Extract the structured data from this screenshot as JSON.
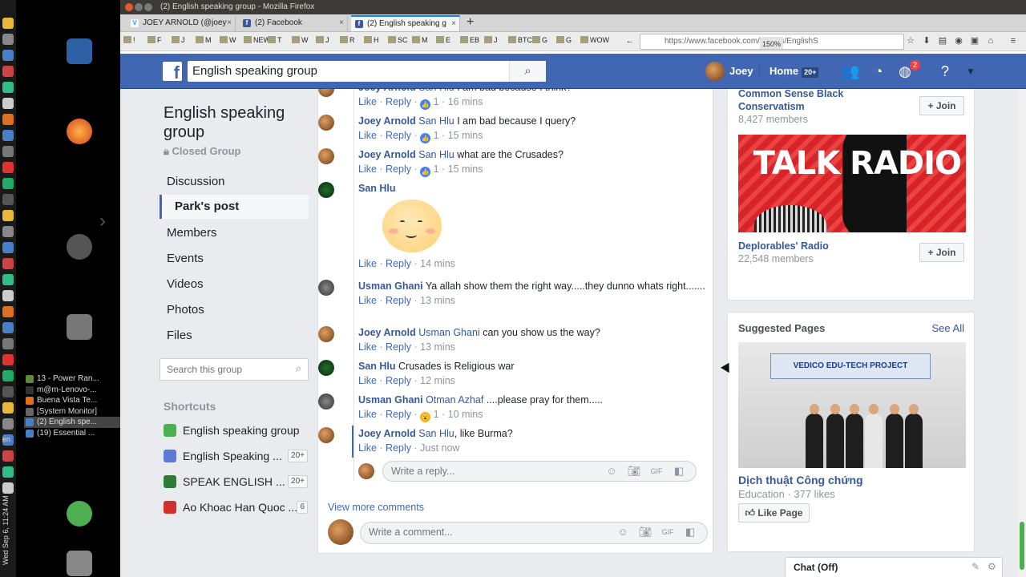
{
  "window": {
    "title": "(2) English speaking group - Mozilla Firefox"
  },
  "tabs": [
    {
      "label": "JOEY ARNOLD (@joey",
      "fav": "V"
    },
    {
      "label": "(2) Facebook",
      "fav": "f"
    },
    {
      "label": "(2) English speaking g",
      "fav": "f"
    }
  ],
  "bookmarks": [
    "!",
    "F",
    "J",
    "M",
    "W",
    "NEW",
    "T",
    "W",
    "J",
    "R",
    "H",
    "SC",
    "M",
    "E",
    "EB",
    "J",
    "BTC",
    "G",
    "G",
    "WOW"
  ],
  "url": "https://www.facebook.com/groups/EnglishS",
  "zoom": "150%",
  "taskbar": [
    {
      "label": "13 - Power Ran...",
      "color": "#5a8a3a"
    },
    {
      "label": "m@m-Lenovo-...",
      "color": "#333"
    },
    {
      "label": "Buena Vista Te...",
      "color": "#e07020"
    },
    {
      "label": "[System Monitor]",
      "color": "#666"
    },
    {
      "label": "(2) English spe...",
      "color": "#4a7fc8"
    },
    {
      "label": "(19) Essential ...",
      "color": "#4a7fc8"
    }
  ],
  "clock": "Wed Sep 6, 11:24 AM",
  "lang": "en",
  "header": {
    "search_value": "English speaking group",
    "user_name": "Joey",
    "home_label": "Home",
    "home_count": "20+",
    "notif_count": "2"
  },
  "group": {
    "title": "English speaking group",
    "type": "Closed Group",
    "nav": [
      "Discussion",
      "Park's post",
      "Members",
      "Events",
      "Videos",
      "Photos",
      "Files"
    ],
    "search_placeholder": "Search this group"
  },
  "shortcuts": {
    "heading": "Shortcuts",
    "items": [
      {
        "label": "English speaking group",
        "count": "",
        "color": "#4caf50"
      },
      {
        "label": "English Speaking ...",
        "count": "20+",
        "color": "#5b7bd5"
      },
      {
        "label": "SPEAK ENGLISH ...",
        "count": "20+",
        "color": "#2e7d32"
      },
      {
        "label": "Ao Khoac Han Quoc ...",
        "count": "6",
        "color": "#d32f2f"
      }
    ]
  },
  "comments": [
    {
      "author": "Joey Arnold",
      "tag": "San Hlu",
      "text": "I am bad because I think?",
      "reactions": "1",
      "time": "16 mins",
      "av": "joey"
    },
    {
      "author": "Joey Arnold",
      "tag": "San Hlu",
      "text": "I am bad because I query?",
      "reactions": "1",
      "time": "15 mins",
      "av": "joey"
    },
    {
      "author": "Joey Arnold",
      "tag": "San Hlu",
      "text": "what are the Crusades?",
      "reactions": "1",
      "time": "15 mins",
      "av": "joey"
    },
    {
      "author": "San Hlu",
      "tag": "",
      "text": "",
      "reactions": "",
      "time": "14 mins",
      "av": "san"
    },
    {
      "author": "Usman Ghani",
      "tag": "",
      "text": "Ya allah show them the right way.....they dunno whats right.......",
      "reactions": "",
      "time": "13 mins",
      "av": "usman"
    },
    {
      "author": "Joey Arnold",
      "tag": "Usman Ghani",
      "text": "can you show us the way?",
      "reactions": "",
      "time": "13 mins",
      "av": "joey"
    },
    {
      "author": "San Hlu",
      "tag": "",
      "text": "Crusades is Religious war",
      "reactions": "",
      "time": "12 mins",
      "av": "san"
    },
    {
      "author": "Usman Ghani",
      "tag": "Otman Azhaf",
      "text": "....please pray for them.....",
      "reactions": "1",
      "time": "10 mins",
      "av": "usman"
    },
    {
      "author": "Joey Arnold",
      "tag": "San Hlu",
      "text": ", like Burma?",
      "reactions": "",
      "time": "Just now",
      "av": "joey"
    }
  ],
  "actions": {
    "like": "Like",
    "reply": "Reply"
  },
  "reply_placeholder": "Write a reply...",
  "comment_placeholder": "Write a comment...",
  "view_more": "View more comments",
  "suggested_groups": [
    {
      "name": "Common Sense Black Conservatism",
      "members": "8,427 members",
      "join": "Join"
    },
    {
      "name": "Deplorables' Radio",
      "members": "22,548 members",
      "join": "Join",
      "image_text": "TALK RADIO"
    }
  ],
  "suggested_pages": {
    "title": "Suggested Pages",
    "see_all": "See All",
    "photo_banner": "VEDICO EDU-TECH PROJECT",
    "name": "Dịch thuật Công chứng",
    "meta": "Education · 377 likes",
    "like_label": "Like Page"
  },
  "chat": {
    "label": "Chat (Off)"
  }
}
